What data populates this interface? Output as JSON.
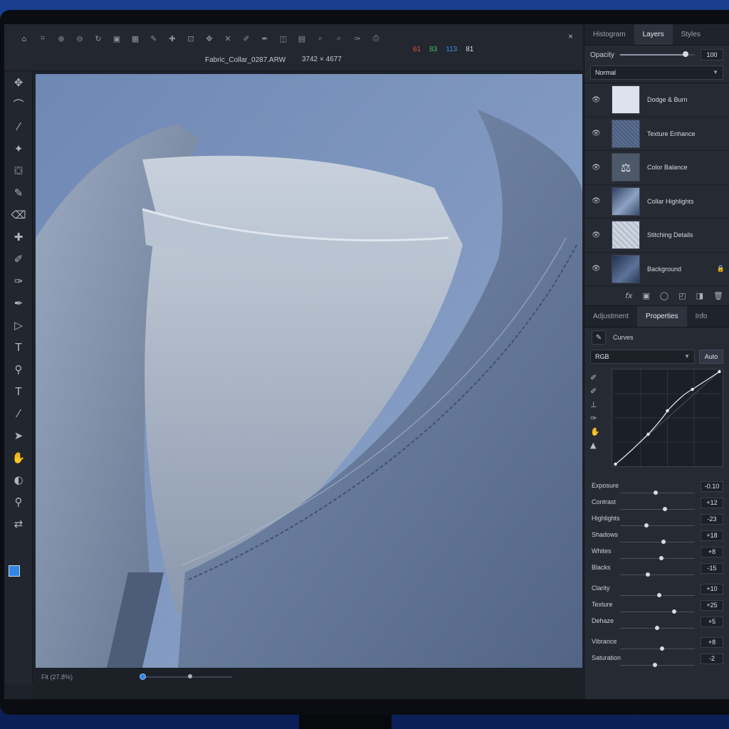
{
  "document": {
    "filename": "Fabric_Collar_0287.ARW",
    "dimensions": "3742 × 4677",
    "rgb": {
      "r": "61",
      "g": "83",
      "b": "113",
      "k": "81"
    },
    "close_glyph": "×"
  },
  "bottom": {
    "zoom_label": "Fit (27.8%)",
    "zoom_fraction": 0.52
  },
  "panel_top": {
    "tabs": [
      {
        "label": "Histogram"
      },
      {
        "label": "Layers"
      },
      {
        "label": "Styles"
      }
    ],
    "active_tab": "Layers",
    "opacity_label": "Opacity",
    "opacity_value": "100",
    "opacity_fraction": 0.88,
    "blend_mode": "Normal"
  },
  "layers": [
    {
      "name": "Dodge & Burn",
      "locked": false
    },
    {
      "name": "Texture Enhance",
      "locked": false
    },
    {
      "name": "Color Balance",
      "locked": false
    },
    {
      "name": "Collar Highlights",
      "locked": false
    },
    {
      "name": "Stitching Details",
      "locked": false
    },
    {
      "name": "Background",
      "locked": true
    }
  ],
  "layer_tools": [
    "fx-icon",
    "mask-icon",
    "adjustment-circle-icon",
    "new-group-icon",
    "new-layer-icon",
    "trash-icon"
  ],
  "panel_bottom": {
    "tabs": [
      {
        "label": "Adjustment"
      },
      {
        "label": "Properties"
      },
      {
        "label": "Info"
      }
    ],
    "active_tab": "Properties",
    "adjustment_type": "Curves",
    "channel": "RGB",
    "auto_label": "Auto"
  },
  "adjustments": [
    {
      "label": "Exposure",
      "value": "-0.10",
      "position": 0.47
    },
    {
      "label": "Contrast",
      "value": "+12",
      "position": 0.59
    },
    {
      "label": "Highlights",
      "value": "-23",
      "position": 0.35
    },
    {
      "label": "Shadows",
      "value": "+18",
      "position": 0.58
    },
    {
      "label": "Whites",
      "value": "+8",
      "position": 0.55
    },
    {
      "label": "Blacks",
      "value": "-15",
      "position": 0.37
    },
    {
      "label": "Clarity",
      "value": "+10",
      "position": 0.52
    },
    {
      "label": "Texture",
      "value": "+25",
      "position": 0.72
    },
    {
      "label": "Dehaze",
      "value": "+5",
      "position": 0.49
    },
    {
      "label": "Vibrance",
      "value": "+8",
      "position": 0.56
    },
    {
      "label": "Saturation",
      "value": "-2",
      "position": 0.46
    }
  ],
  "colors": {
    "accent": "#2f86e6",
    "foreground_swatch": "#2f86e6",
    "background_swatch": "#111111"
  }
}
